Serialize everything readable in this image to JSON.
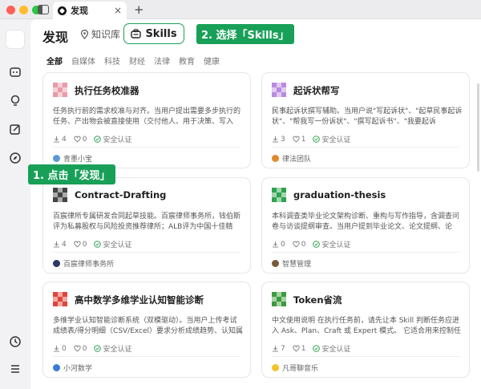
{
  "window": {
    "tab_title": "发现",
    "tab_close": "×",
    "new_tab": "+"
  },
  "header": {
    "title": "发现",
    "knowledge_base": "知识库",
    "skills": "Skills"
  },
  "callouts": {
    "step1": "1. 点击「发现」",
    "step2": "2. 选择「Skills」"
  },
  "categories": [
    "全部",
    "自媒体",
    "科技",
    "财经",
    "法律",
    "教育",
    "健康"
  ],
  "cards": [
    {
      "title": "执行任务校准器",
      "desc": "任务执行前的需求校准与对齐。当用户提出需要多步执行的任务、产出物会被直接使用（交付他人、用于决策、写入文...",
      "downloads": "4",
      "likes": "0",
      "verified": "安全认证",
      "author": "青墨小宝",
      "icon_color": "#e89ba8",
      "avatar_color": "#5a9bd5"
    },
    {
      "title": "起诉状帮写",
      "desc": "民事起诉状撰写辅助。当用户说\"写起诉状\"、\"起草民事起诉状\"、\"帮我写一份诉状\"、\"撰写起诉书\"、\"我要起诉XX\"，...",
      "downloads": "3",
      "likes": "1",
      "verified": "安全认证",
      "author": "律法团队",
      "icon_color": "#b98be0",
      "avatar_color": "#e08a2e"
    },
    {
      "title": "Contract-Drafting",
      "desc": "百宸律所专属研发合同起草技能。百宸律师事务所，钱伯斯评为私募股权与风险投资推荐律所；ALB评为中国十佳精品...",
      "downloads": "4",
      "likes": "0",
      "verified": "安全认证",
      "author": "百宸律师事务所",
      "icon_color": "#444444",
      "avatar_color": "#2b3a67"
    },
    {
      "title": "graduation-thesis",
      "desc": "本科调查类毕业论文架构诊断、重构与写作指导，含调查问卷与访谈提纲审查。当用户提到毕业论文、论文提纲、论文...",
      "downloads": "0",
      "likes": "0",
      "verified": "安全认证",
      "author": "智慧管理",
      "icon_color": "#2fa34f",
      "avatar_color": "#7a5a3a"
    },
    {
      "title": "高中数学多维学业认知智能诊断",
      "desc": "多维学业认知智能诊断系统（双模驱动）。当用户上传考试成绩表/得分明细（CSV/Excel）要求分析成绩趋势、认知属性...",
      "downloads": "0",
      "likes": "0",
      "verified": "安全认证",
      "author": "小河数学",
      "icon_color": "#e0453a",
      "avatar_color": "#3a7bd5"
    },
    {
      "title": "Token省流",
      "desc": "中文使用说明 在执行任务前，请先让本 Skill 判断任务应进入 Ask、Plan、Craft 或 Expert 模式。 它适合用来控制任务...",
      "downloads": "7",
      "likes": "1",
      "verified": "安全认证",
      "author": "凡哥聊音乐",
      "icon_color": "#3c9b3c",
      "avatar_color": "#f2c330"
    }
  ]
}
